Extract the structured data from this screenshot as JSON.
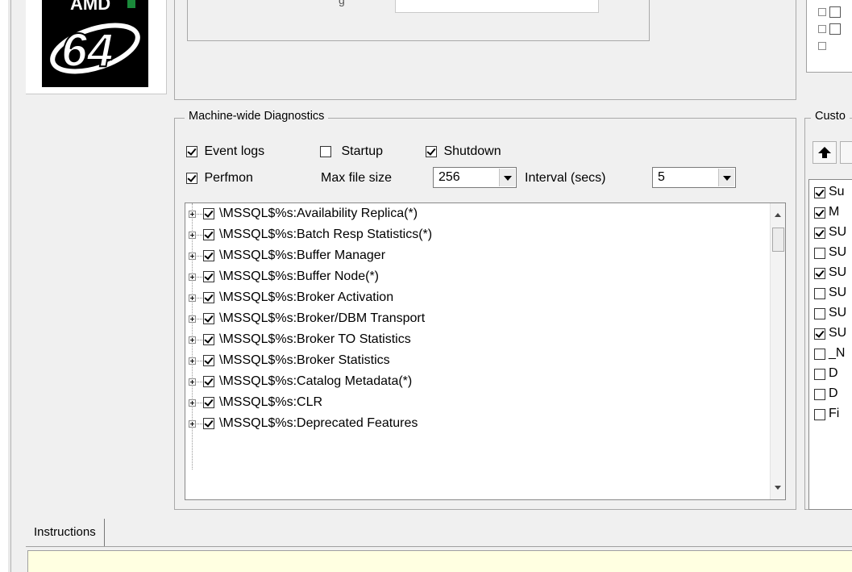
{
  "logo": {
    "text": "64"
  },
  "top_group": {
    "label_fragment": "g"
  },
  "machine_diag": {
    "title": "Machine-wide Diagnostics",
    "event_logs": {
      "label": "Event logs",
      "checked": true
    },
    "startup": {
      "label": "Startup",
      "checked": false
    },
    "shutdown": {
      "label": "Shutdown",
      "checked": true
    },
    "perfmon": {
      "label": "Perfmon",
      "checked": true
    },
    "max_file_size": {
      "label": "Max file size",
      "value": "256"
    },
    "interval": {
      "label": "Interval (secs)",
      "value": "5"
    },
    "counters": [
      "\\MSSQL$%s:Availability Replica(*)",
      "\\MSSQL$%s:Batch Resp Statistics(*)",
      "\\MSSQL$%s:Buffer Manager",
      "\\MSSQL$%s:Buffer Node(*)",
      "\\MSSQL$%s:Broker Activation",
      "\\MSSQL$%s:Broker/DBM Transport",
      "\\MSSQL$%s:Broker TO Statistics",
      "\\MSSQL$%s:Broker Statistics",
      "\\MSSQL$%s:Catalog Metadata(*)",
      "\\MSSQL$%s:CLR",
      "\\MSSQL$%s:Deprecated Features"
    ]
  },
  "custom": {
    "title": "Custo",
    "items": [
      {
        "text": "Su",
        "checked": true
      },
      {
        "text": "M",
        "checked": true
      },
      {
        "text": "SU",
        "checked": true
      },
      {
        "text": "SU",
        "checked": false
      },
      {
        "text": "SU",
        "checked": true
      },
      {
        "text": "SU",
        "checked": false
      },
      {
        "text": "SU",
        "checked": false
      },
      {
        "text": "SU",
        "checked": true
      },
      {
        "text": "_N",
        "checked": false
      },
      {
        "text": "D",
        "checked": false
      },
      {
        "text": "D",
        "checked": false
      },
      {
        "text": "Fi",
        "checked": false
      }
    ]
  },
  "tabs": {
    "instructions": "Instructions"
  }
}
